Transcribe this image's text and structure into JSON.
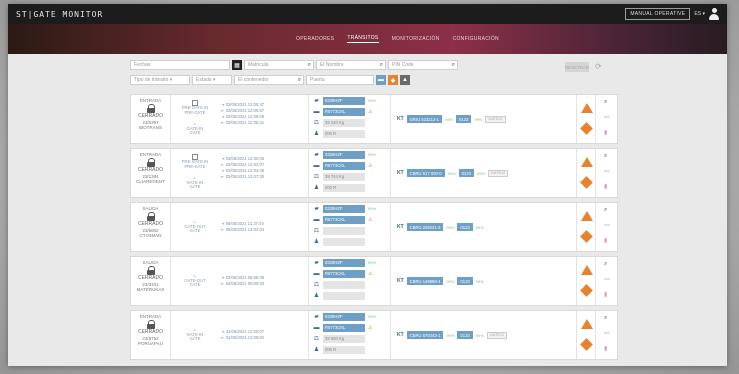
{
  "header": {
    "logo": "ST|GATE MONITOR",
    "account": "MANUAL OPERATIVE",
    "lang": "ES ▾"
  },
  "nav": {
    "items": [
      "OPERADORES",
      "TRÁNSITOS",
      "MONITORIZACIÓN",
      "CONFIGURACIÓN"
    ],
    "active_index": 1
  },
  "filters": {
    "fechas": "Fechas",
    "matricula": "Matrícula",
    "nombre": "El Nombre",
    "pin": "PIN Code",
    "tipo": "Tipo de tránsito",
    "estado": "Estado",
    "contenedor": "El contenedor",
    "puerta": "Puerta",
    "reset": "RESETEAR"
  },
  "colors": {
    "accent_blue": "#6e9fc4",
    "warning_orange": "#e8832d",
    "ok_green": "#7dc27d",
    "nav_band": "#8c2f48"
  },
  "rows": [
    {
      "direction": "ENTRADA",
      "status": "CERRADO",
      "info1": "23/6397",
      "info2": "BIOTRANS",
      "gate1": "PRE-GATE IN",
      "gate1_sub": "PRE-GATE",
      "gate2": "GATE-IN",
      "gate2_sub": "GATE",
      "t1": "03/05/2021 12:05:47",
      "t2": "03/05/2021 12:05:57",
      "t3": "03/05/2021 12:06:06",
      "t4": "03/05/2021 12:06:21",
      "plate": "0328HZF",
      "truck": "R6773CKL",
      "weight": "39 240 Kg",
      "driver": "000 R",
      "container": "GRIU 523212-1",
      "seal": "0123",
      "extra": "GATE12"
    },
    {
      "direction": "ENTRADA",
      "status": "CERRADO",
      "info1": "23/1384",
      "info2": "CLIAREGENT",
      "gate1": "PRE-GATE IN",
      "gate1_sub": "PRE-GATE",
      "gate2": "GATE-IN",
      "gate2_sub": "GATE",
      "t1": "03/05/2021 12:00:06",
      "t2": "03/05/2021 12:02:07",
      "t3": "03/05/2021 12:04:06",
      "t4": "03/05/2021 12:07:30",
      "plate": "0328HZF",
      "truck": "R6773CKL",
      "weight": "39 744 Kg",
      "driver": "000 R",
      "container": "CBRU 617 000-0",
      "seal": "0123",
      "extra": "GATE12"
    },
    {
      "direction": "SALIDA",
      "status": "CERRADO",
      "info1": "23/6602",
      "info2": "CTO4MAN",
      "gate1": "",
      "gate1_sub": "",
      "gate2": "GATE-OUT",
      "gate2_sub": "GATE",
      "t1": "",
      "t2": "",
      "t3": "05/05/2021 11:37:44",
      "t4": "05/05/2021 12:02:04",
      "plate": "0328HZF",
      "truck": "R6773CKL",
      "weight": "",
      "driver": "",
      "container": "CBRU 226231-3",
      "seal": "0123",
      "extra": ""
    },
    {
      "direction": "SALIDA",
      "status": "CERRADO",
      "info1": "23/3331",
      "info2": "MATERUKAS",
      "gate1": "",
      "gate1_sub": "",
      "gate2": "GATE-OUT",
      "gate2_sub": "GATE",
      "t1": "",
      "t2": "",
      "t3": "03/05/2021 08:58:09",
      "t4": "03/05/2021 09:09:03",
      "plate": "0328HZF",
      "truck": "R6773CKL",
      "weight": "",
      "driver": "",
      "container": "CBRU 148899-4",
      "seal": "0123",
      "extra": ""
    },
    {
      "direction": "ENTRADA",
      "status": "CERRADO",
      "info1": "23/8752",
      "info2": "PORUAPAU",
      "gate1": "",
      "gate1_sub": "",
      "gate2": "GATE-IN",
      "gate2_sub": "GATE",
      "t1": "",
      "t2": "",
      "t3": "31/05/2021 12:06:07",
      "t4": "31/05/2021 12:09:02",
      "plate": "0328HZF",
      "truck": "R6773CKL",
      "weight": "39 500 Kg",
      "driver": "000 R",
      "container": "CBRU 570443-1",
      "seal": "0123",
      "extra": "GATE12"
    }
  ]
}
